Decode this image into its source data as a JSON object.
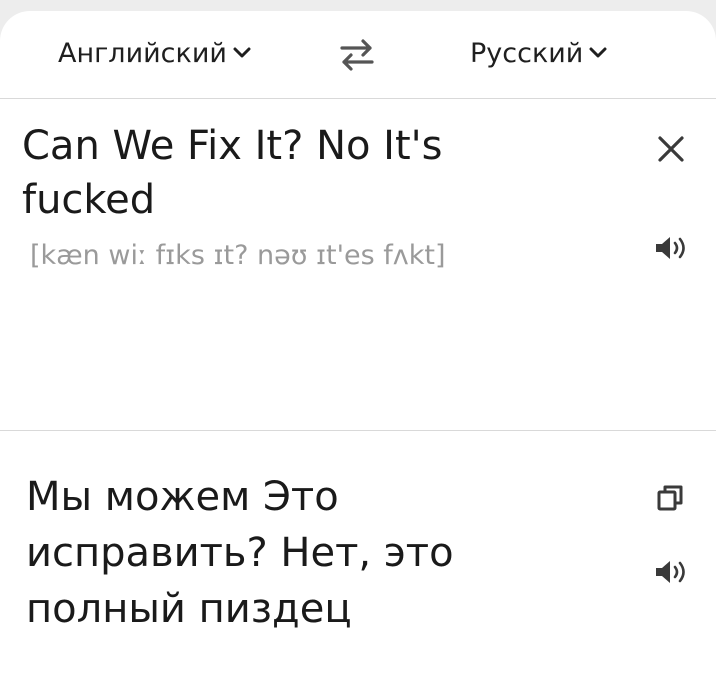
{
  "languages": {
    "source": "Английский",
    "target": "Русский"
  },
  "icons": {
    "source_dropdown": "chevron-down-icon",
    "target_dropdown": "chevron-down-icon",
    "swap": "swap-arrows-icon",
    "clear": "close-icon",
    "speak_source": "speaker-icon",
    "copy": "copy-icon",
    "speak_target": "speaker-icon"
  },
  "source": {
    "text": "Can We Fix It? No It's fucked",
    "transcription": "[kæn wiː fɪks ɪt? nəʊ ɪt'es fʌkt]"
  },
  "translation": {
    "text": "Мы можем Это исправить? Нет, это полный пиздец"
  },
  "colors": {
    "background": "#ededed",
    "card": "#ffffff",
    "text": "#1a1a1a",
    "transcription": "#9a9a9a",
    "divider": "#d9d9d9"
  }
}
